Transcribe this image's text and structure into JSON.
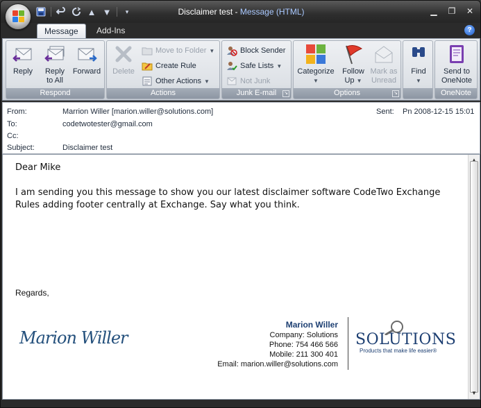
{
  "window": {
    "title": "Disclaimer test",
    "title_sep": " - ",
    "app": "Message (HTML)"
  },
  "tabs": [
    {
      "label": "Message",
      "active": true
    },
    {
      "label": "Add-Ins",
      "active": false
    }
  ],
  "ribbon": {
    "respond": {
      "label": "Respond",
      "reply": "Reply",
      "reply_all_1": "Reply",
      "reply_all_2": "to All",
      "forward": "Forward"
    },
    "actions": {
      "label": "Actions",
      "delete": "Delete",
      "move_to_folder": "Move to Folder",
      "create_rule": "Create Rule",
      "other_actions": "Other Actions"
    },
    "junk": {
      "label": "Junk E-mail",
      "block_sender": "Block Sender",
      "safe_lists": "Safe Lists",
      "not_junk": "Not Junk"
    },
    "options": {
      "label": "Options",
      "categorize": "Categorize",
      "follow_up_1": "Follow",
      "follow_up_2": "Up",
      "mark_unread_1": "Mark as",
      "mark_unread_2": "Unread"
    },
    "find": {
      "label": "Find"
    },
    "onenote": {
      "label": "OneNote",
      "send_1": "Send to",
      "send_2": "OneNote"
    }
  },
  "header": {
    "from_label": "From:",
    "from_value": "Marrion Willer [marion.willer@solutions.com]",
    "to_label": "To:",
    "to_value": "codetwotester@gmail.com",
    "cc_label": "Cc:",
    "cc_value": "",
    "subject_label": "Subject:",
    "subject_value": "Disclaimer test",
    "sent_label": "Sent:",
    "sent_value": "Pn 2008-12-15 15:01"
  },
  "body": {
    "greeting": "Dear Mike",
    "paragraph": "I am sending you this message to show you our latest disclaimer software CodeTwo Exchange Rules adding footer centrally at Exchange. Say what you think.",
    "closing": "Regards,",
    "handwritten_signature": "Marion Willer"
  },
  "signature": {
    "name": "Marion Willer",
    "company": "Company:  Solutions",
    "phone": "Phone: 754 466 566",
    "mobile": "Mobile: 211 300 401",
    "email": "Email: marion.willer@solutions.com",
    "logo_word": "SOLUTIONS",
    "logo_tagline": "Products that make life easier®"
  },
  "colors": {
    "accent": "#1d3f72",
    "title_app": "#a9c8ff"
  }
}
